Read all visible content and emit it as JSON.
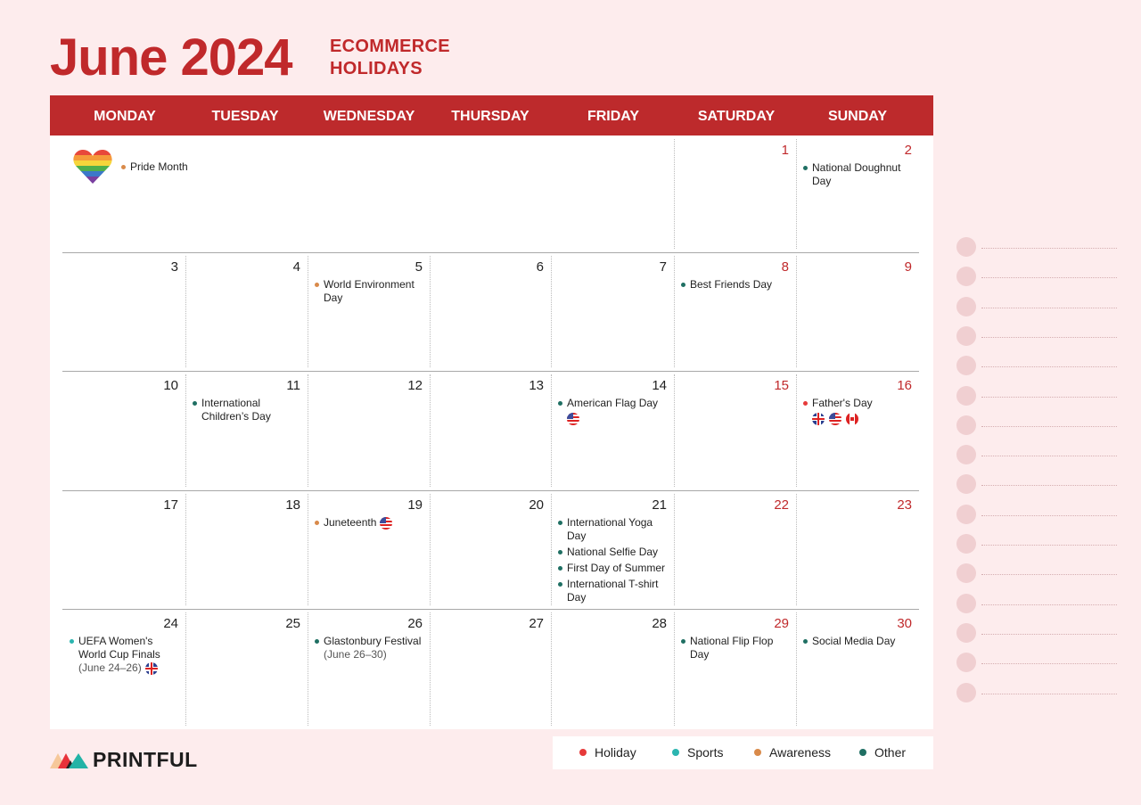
{
  "header": {
    "title": "June 2024",
    "subtitle_line1": "ECOMMERCE",
    "subtitle_line2": "HOLIDAYS"
  },
  "colors": {
    "brand_red": "#bd2a2c",
    "background": "#fdeced",
    "holiday": "#e63a3a",
    "sports": "#2bb5b0",
    "awareness": "#d98a4a",
    "other": "#1f6f63"
  },
  "weekdays": [
    "MONDAY",
    "TUESDAY",
    "WEDNESDAY",
    "THURSDAY",
    "FRIDAY",
    "SATURDAY",
    "SUNDAY"
  ],
  "month_banner": {
    "icon": "rainbow-heart-icon",
    "event": {
      "label": "Pride Month",
      "category": "awareness"
    }
  },
  "weeks": [
    [
      {
        "day": null
      },
      {
        "day": null
      },
      {
        "day": null
      },
      {
        "day": null
      },
      {
        "day": null
      },
      {
        "day": "1",
        "events": []
      },
      {
        "day": "2",
        "events": [
          {
            "label": "National Doughnut Day",
            "category": "other"
          }
        ]
      }
    ],
    [
      {
        "day": "3",
        "events": []
      },
      {
        "day": "4",
        "events": []
      },
      {
        "day": "5",
        "events": [
          {
            "label": "World Environment Day",
            "category": "awareness"
          }
        ]
      },
      {
        "day": "6",
        "events": []
      },
      {
        "day": "7",
        "events": []
      },
      {
        "day": "8",
        "events": [
          {
            "label": "Best Friends Day",
            "category": "other"
          }
        ]
      },
      {
        "day": "9",
        "events": []
      }
    ],
    [
      {
        "day": "10",
        "events": []
      },
      {
        "day": "11",
        "events": [
          {
            "label": "International Children’s Day",
            "category": "other"
          }
        ]
      },
      {
        "day": "12",
        "events": []
      },
      {
        "day": "13",
        "events": []
      },
      {
        "day": "14",
        "events": [
          {
            "label": "American Flag Day",
            "category": "other",
            "flags_below": [
              "us"
            ]
          }
        ]
      },
      {
        "day": "15",
        "events": []
      },
      {
        "day": "16",
        "events": [
          {
            "label": "Father's Day",
            "category": "holiday",
            "flags_below": [
              "uk",
              "us",
              "ca"
            ]
          }
        ]
      }
    ],
    [
      {
        "day": "17",
        "events": []
      },
      {
        "day": "18",
        "events": []
      },
      {
        "day": "19",
        "events": [
          {
            "label": "Juneteenth",
            "category": "awareness",
            "flags_inline": [
              "us"
            ]
          }
        ]
      },
      {
        "day": "20",
        "events": []
      },
      {
        "day": "21",
        "events": [
          {
            "label": "International Yoga Day",
            "category": "other"
          },
          {
            "label": "National Selfie Day",
            "category": "other"
          },
          {
            "label": "First Day of Summer",
            "category": "other"
          },
          {
            "label": "International T-shirt Day",
            "category": "other"
          }
        ]
      },
      {
        "day": "22",
        "events": []
      },
      {
        "day": "23",
        "events": []
      }
    ],
    [
      {
        "day": "24",
        "events": [
          {
            "label": "UEFA Women's World Cup Finals",
            "category": "sports",
            "note": "(June 24–26)",
            "flags_inline_note": [
              "uk"
            ]
          }
        ]
      },
      {
        "day": "25",
        "events": []
      },
      {
        "day": "26",
        "events": [
          {
            "label": "Glastonbury Festival",
            "category": "other",
            "note": "(June 26–30)"
          }
        ]
      },
      {
        "day": "27",
        "events": []
      },
      {
        "day": "28",
        "events": []
      },
      {
        "day": "29",
        "events": [
          {
            "label": "National Flip Flop Day",
            "category": "other"
          }
        ]
      },
      {
        "day": "30",
        "events": [
          {
            "label": "Social Media Day",
            "category": "other"
          }
        ]
      }
    ]
  ],
  "legend": [
    {
      "label": "Holiday",
      "category": "holiday"
    },
    {
      "label": "Sports",
      "category": "sports"
    },
    {
      "label": "Awareness",
      "category": "awareness"
    },
    {
      "label": "Other",
      "category": "other"
    }
  ],
  "logo": {
    "text": "PRINTFUL"
  },
  "notes_lines_count": 16
}
